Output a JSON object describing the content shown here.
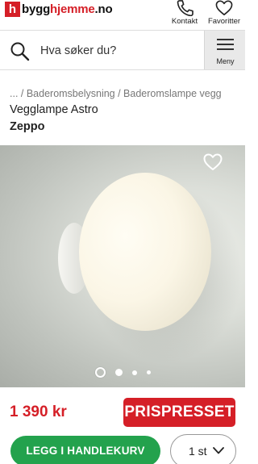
{
  "header": {
    "logo_letter": "h",
    "logo_prefix": "bygg",
    "logo_highlight": "hjemme",
    "logo_suffix": ".no",
    "kontakt_label": "Kontakt",
    "favoritter_label": "Favoritter"
  },
  "search": {
    "placeholder": "Hva søker du?",
    "menu_label": "Meny"
  },
  "breadcrumb": "... / Baderomsbelysning / Baderomslampe vegg",
  "product": {
    "title": "Vegglampe Astro",
    "brand": "Zeppo",
    "price": "1 390 kr",
    "badge": "PRISPRESSET"
  },
  "gallery": {
    "total_images": 4,
    "active_index": 0
  },
  "cart": {
    "add_label": "LEGG I HANDLEKURV",
    "quantity": "1 st"
  },
  "colors": {
    "brand_red": "#d51f27",
    "cart_green": "#23a24d"
  }
}
